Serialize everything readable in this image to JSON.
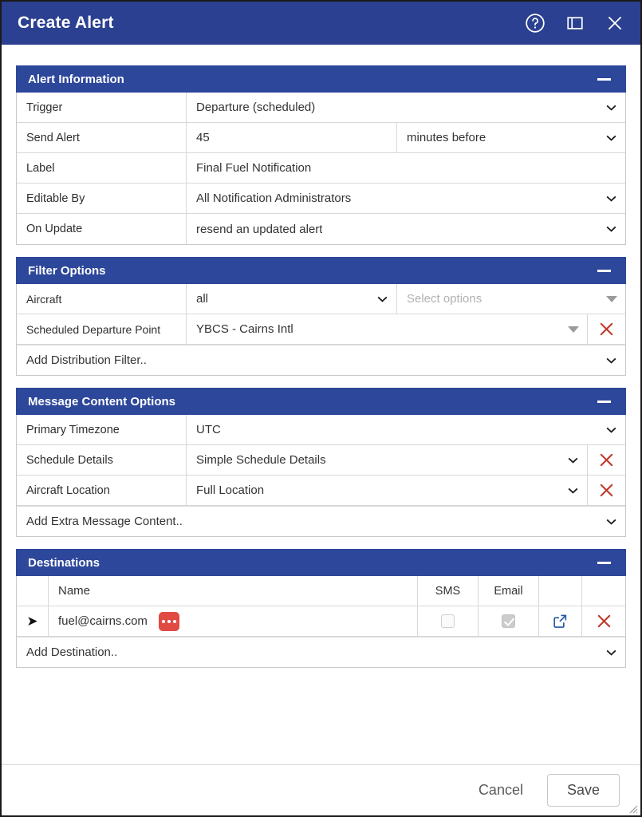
{
  "titlebar": {
    "title": "Create Alert",
    "help_icon": "help-circle-icon",
    "restore_icon": "restore-window-icon",
    "close_icon": "close-icon"
  },
  "sections": {
    "alert_information": {
      "title": "Alert Information",
      "rows": [
        {
          "label": "Trigger",
          "value": "Departure (scheduled)",
          "control": "select"
        },
        {
          "label": "Send Alert",
          "value": "45",
          "control": "text-split",
          "value2": "minutes before",
          "control2": "select"
        },
        {
          "label": "Label",
          "value": "Final Fuel Notification",
          "control": "text"
        },
        {
          "label": "Editable By",
          "value": "All Notification Administrators",
          "control": "select"
        },
        {
          "label": "On Update",
          "value": "resend an updated alert",
          "control": "select"
        }
      ]
    },
    "filter_options": {
      "title": "Filter Options",
      "rows": [
        {
          "label": "Aircraft",
          "value": "all",
          "control": "select",
          "value2": "Select options",
          "value2_is_placeholder": true,
          "control2": "multiselect",
          "deletable": false
        },
        {
          "label": "Scheduled Departure Point",
          "value": "YBCS - Cairns Intl",
          "control": "multiselect",
          "deletable": true
        }
      ],
      "add_row": "Add Distribution Filter.."
    },
    "message_content_options": {
      "title": "Message Content Options",
      "rows": [
        {
          "label": "Primary Timezone",
          "value": "UTC",
          "control": "select",
          "deletable": false
        },
        {
          "label": "Schedule Details",
          "value": "Simple Schedule Details",
          "control": "select",
          "deletable": true
        },
        {
          "label": "Aircraft Location",
          "value": "Full Location",
          "control": "select",
          "deletable": true
        }
      ],
      "add_row": "Add Extra Message Content.."
    },
    "destinations": {
      "title": "Destinations",
      "columns": {
        "name": "Name",
        "sms": "SMS",
        "email": "Email"
      },
      "rows": [
        {
          "name": "fuel@cairns.com",
          "badge": "more-options-dots",
          "sms_checked": false,
          "email_checked": true,
          "email_disabled": true,
          "open_icon": "external-link-icon",
          "delete_icon": "delete-icon"
        }
      ],
      "add_row": "Add Destination.."
    }
  },
  "footer": {
    "cancel_label": "Cancel",
    "save_label": "Save"
  },
  "colors": {
    "titlebar_blue": "#2b4090",
    "section_blue": "#2d479b",
    "delete_red": "#c0392b",
    "badge_red": "#e04a43",
    "link_blue": "#2255a4"
  }
}
